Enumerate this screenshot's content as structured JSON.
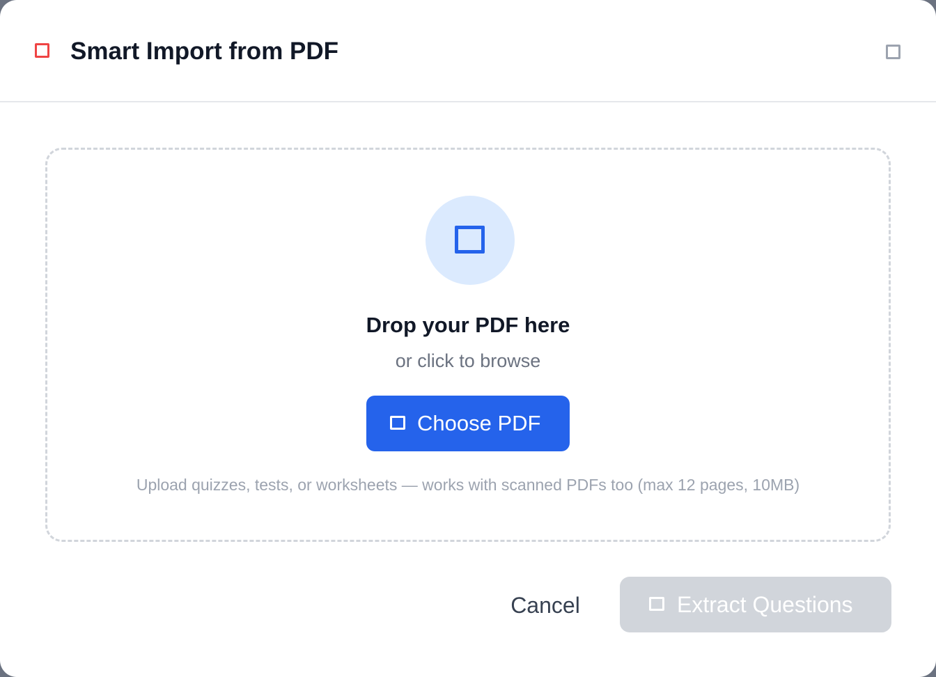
{
  "dialog": {
    "title": "Smart Import from PDF",
    "title_icon": "document-icon",
    "close_icon": "close-icon"
  },
  "dropzone": {
    "icon": "upload-icon",
    "title": "Drop your PDF here",
    "subtitle": "or click to browse",
    "choose_button_label": "Choose PDF",
    "choose_button_icon": "file-icon",
    "hint": "Upload quizzes, tests, or worksheets — works with scanned PDFs too (max 12 pages, 10MB)"
  },
  "footer": {
    "cancel_label": "Cancel",
    "extract_label": "Extract Questions",
    "extract_icon": "sparkle-icon",
    "extract_disabled": true
  },
  "colors": {
    "accent": "#2563eb",
    "accent_light": "#dbeafe",
    "danger": "#ef4444",
    "disabled": "#d1d5db",
    "title_text": "#111827",
    "muted_text": "#6b7280"
  }
}
